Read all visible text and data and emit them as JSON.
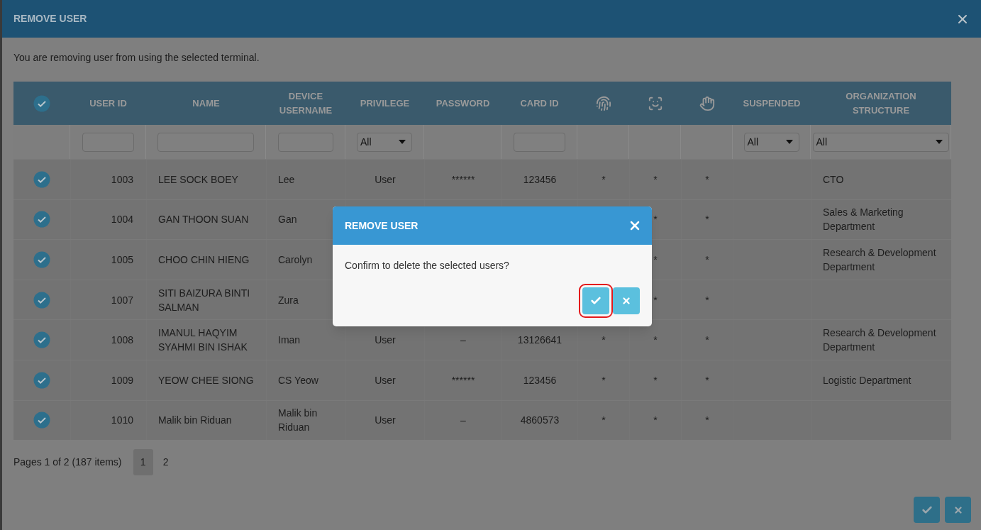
{
  "window": {
    "title": "REMOVE USER"
  },
  "description": "You are removing user from using the selected terminal.",
  "table": {
    "columns": [
      {
        "kind": "select_all",
        "checked": true
      },
      {
        "kind": "text",
        "label": "USER ID"
      },
      {
        "kind": "text",
        "label": "NAME"
      },
      {
        "kind": "text",
        "label": "DEVICE USERNAME"
      },
      {
        "kind": "text",
        "label": "PRIVILEGE"
      },
      {
        "kind": "text",
        "label": "PASSWORD"
      },
      {
        "kind": "text",
        "label": "CARD ID"
      },
      {
        "kind": "icon"
      },
      {
        "kind": "icon"
      },
      {
        "kind": "icon"
      },
      {
        "kind": "text",
        "label": "SUSPENDED"
      },
      {
        "kind": "text",
        "label": "ORGANIZATION STRUCTURE"
      }
    ],
    "filters": [
      {
        "kind": "none"
      },
      {
        "kind": "text"
      },
      {
        "kind": "text"
      },
      {
        "kind": "text"
      },
      {
        "kind": "select",
        "value": "All"
      },
      {
        "kind": "none"
      },
      {
        "kind": "text"
      },
      {
        "kind": "none"
      },
      {
        "kind": "none"
      },
      {
        "kind": "none"
      },
      {
        "kind": "select",
        "value": "All"
      },
      {
        "kind": "select",
        "value": "All"
      }
    ],
    "rows": [
      {
        "checked": true,
        "user_id": "1003",
        "name": "LEE SOCK BOEY",
        "device_username": "Lee",
        "privilege": "User",
        "password": "******",
        "card_id": "123456",
        "fingerprint": "*",
        "face": "*",
        "hand": "*",
        "organization": "CTO"
      },
      {
        "checked": true,
        "user_id": "1004",
        "name": "GAN THOON SUAN",
        "device_username": "Gan",
        "face": "*",
        "hand": "*",
        "organization": "Sales & Marketing Department"
      },
      {
        "checked": true,
        "user_id": "1005",
        "name": "CHOO CHIN HIENG",
        "device_username": "Carolyn",
        "face": "*",
        "hand": "*",
        "organization": "Research & Development Department"
      },
      {
        "checked": true,
        "user_id": "1007",
        "name": "SITI BAIZURA BINTI SALMAN",
        "device_username": "Zura",
        "face": "*",
        "hand": "*"
      },
      {
        "checked": true,
        "user_id": "1008",
        "name": "IMANUL HAQYIM SYAHMI BIN ISHAK",
        "device_username": "Iman",
        "privilege": "User",
        "password": "–",
        "card_id": "13126641",
        "fingerprint": "*",
        "face": "*",
        "hand": "*",
        "organization": "Research & Development Department"
      },
      {
        "checked": true,
        "user_id": "1009",
        "name": "YEOW CHEE SIONG",
        "device_username": "CS Yeow",
        "privilege": "User",
        "password": "******",
        "card_id": "123456",
        "fingerprint": "*",
        "face": "*",
        "hand": "*",
        "organization": "Logistic Department"
      },
      {
        "checked": true,
        "user_id": "1010",
        "name": "Malik bin Riduan",
        "device_username": "Malik bin Riduan",
        "privilege": "User",
        "password": "–",
        "card_id": "4860573",
        "fingerprint": "*",
        "face": "*",
        "hand": "*"
      }
    ]
  },
  "pagination": {
    "summary": "Pages 1 of 2 (187 items)",
    "pages": [
      {
        "label": "1",
        "selected": true
      },
      {
        "label": "2",
        "selected": false
      }
    ]
  },
  "footer_buttons": [
    {
      "kind": "confirm"
    },
    {
      "kind": "cancel"
    }
  ],
  "dialog": {
    "title": "REMOVE USER",
    "message": "Confirm to delete the selected users?",
    "buttons": [
      {
        "kind": "confirm",
        "highlighted": true
      },
      {
        "kind": "cancel",
        "highlighted": false
      }
    ]
  }
}
